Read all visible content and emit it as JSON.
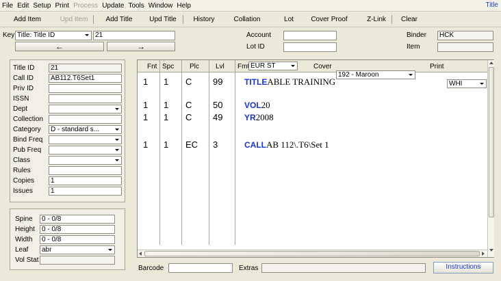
{
  "menubar": {
    "items": [
      "File",
      "Edit",
      "Setup",
      "Print",
      "Process",
      "Update",
      "Tools",
      "Window",
      "Help"
    ],
    "right_label": "Title"
  },
  "toolbar": {
    "add_item": "Add Item",
    "upd_item": "Upd Item",
    "add_title": "Add Title",
    "upd_title": "Upd Title",
    "history": "History",
    "collation": "Collation",
    "lot": "Lot",
    "cover_proof": "Cover Proof",
    "z_link": "Z-Link",
    "clear": "Clear"
  },
  "keybar": {
    "key_label": "Key",
    "key_select": "Title: Title ID",
    "key_value": "21",
    "prev_arrow": "←",
    "next_arrow": "→",
    "account_label": "Account",
    "account_value": "",
    "lotid_label": "Lot ID",
    "lotid_value": "",
    "binder_label": "Binder",
    "binder_value": "HCK",
    "item_label": "Item",
    "item_value": ""
  },
  "title_panel": {
    "fields": [
      {
        "label": "Title ID",
        "value": "21"
      },
      {
        "label": "Call ID",
        "value": "AB112.T6Set1"
      },
      {
        "label": "Priv ID",
        "value": ""
      },
      {
        "label": "ISSN",
        "value": ""
      },
      {
        "label": "Dept",
        "value": ""
      },
      {
        "label": "Collection",
        "value": ""
      },
      {
        "label": "Category",
        "value": "D - standard s..."
      },
      {
        "label": "Bind Freq",
        "value": ""
      },
      {
        "label": "Pub Freq",
        "value": ""
      },
      {
        "label": "Class",
        "value": ""
      },
      {
        "label": "Rules",
        "value": ""
      },
      {
        "label": "Copies",
        "value": "1"
      },
      {
        "label": "Issues",
        "value": "1"
      }
    ]
  },
  "spine_panel": {
    "fields": [
      {
        "label": "Spine",
        "value": "0 - 0/8"
      },
      {
        "label": "Height",
        "value": "0 - 0/8"
      },
      {
        "label": "Width",
        "value": "0 - 0/8"
      },
      {
        "label": "Leaf",
        "value": "abr"
      },
      {
        "label": "Vol Stat",
        "value": ""
      }
    ]
  },
  "grid": {
    "headers": {
      "fnt": "Fnt",
      "spc": "Spc",
      "plc": "Plc",
      "lvl": "Lvl",
      "fmt": "Fmt",
      "cover": "Cover",
      "print": "Print"
    },
    "fmt_value": "EUR ST",
    "cover_value": "192 - Maroon",
    "print_value": "WHI",
    "rows": [
      {
        "fnt": "1",
        "spc": "1",
        "plc": "C",
        "lvl": "99",
        "kw": "TITLE",
        "text": "ABLE TRAINING"
      },
      {
        "fnt": "1",
        "spc": "1",
        "plc": "C",
        "lvl": "50",
        "kw": "VOL",
        "text": "20"
      },
      {
        "fnt": "1",
        "spc": "1",
        "plc": "C",
        "lvl": "49",
        "kw": "YR",
        "text": "2008"
      },
      {
        "fnt": "1",
        "spc": "1",
        "plc": "EC",
        "lvl": "3",
        "kw": "CALL",
        "text": "AB 112\\.T6\\Set 1"
      }
    ]
  },
  "footer": {
    "barcode_label": "Barcode",
    "barcode_value": "",
    "extras_label": "Extras",
    "extras_value": "",
    "instructions": "Instructions"
  }
}
